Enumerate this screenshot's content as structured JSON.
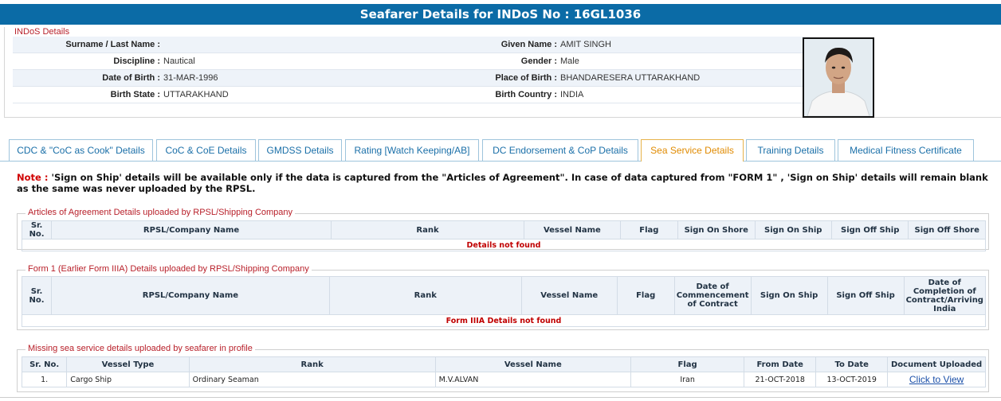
{
  "header": {
    "title": "Seafarer Details for INDoS No : 16GL1036"
  },
  "indos": {
    "legend": "INDoS Details",
    "rows": [
      {
        "l1": "Surname / Last Name :",
        "v1": "",
        "l2": "Given Name :",
        "v2": "AMIT SINGH"
      },
      {
        "l1": "Discipline :",
        "v1": "Nautical",
        "l2": "Gender :",
        "v2": "Male"
      },
      {
        "l1": "Date of Birth :",
        "v1": "31-MAR-1996",
        "l2": "Place of Birth :",
        "v2": "BHANDARESERA UTTARAKHAND"
      },
      {
        "l1": "Birth State :",
        "v1": "UTTARAKHAND",
        "l2": "Birth Country :",
        "v2": "INDIA"
      }
    ]
  },
  "tabs": [
    "CDC & \"CoC as Cook\" Details",
    "CoC & CoE Details",
    "GMDSS Details",
    "Rating [Watch Keeping/AB]",
    "DC Endorsement & CoP Details",
    "Sea Service Details",
    "Training Details",
    "Medical Fitness Certificate"
  ],
  "note": {
    "prefix": "Note :",
    "text": " 'Sign on Ship' details will be available only if the data is captured from the \"Articles of Agreement\". In case of data captured from \"FORM 1\" , 'Sign on Ship' details will remain blank as the same was never uploaded by the RPSL."
  },
  "articles": {
    "legend": "Articles of Agreement Details uploaded by RPSL/Shipping Company",
    "headers": [
      "Sr. No.",
      "RPSL/Company Name",
      "Rank",
      "Vessel Name",
      "Flag",
      "Sign On Shore",
      "Sign On Ship",
      "Sign Off Ship",
      "Sign Off Shore"
    ],
    "empty": "Details not found"
  },
  "form1": {
    "legend": "Form 1 (Earlier Form IIIA) Details uploaded by RPSL/Shipping Company",
    "headers": [
      "Sr. No.",
      "RPSL/Company Name",
      "Rank",
      "Vessel Name",
      "Flag",
      "Date of Commencement of Contract",
      "Sign On Ship",
      "Sign Off Ship",
      "Date of Completion of Contract/Arriving India"
    ],
    "empty": "Form IIIA Details not found"
  },
  "missing": {
    "legend": "Missing sea service details uploaded by seafarer in profile",
    "headers": [
      "Sr. No.",
      "Vessel Type",
      "Rank",
      "Vessel Name",
      "Flag",
      "From Date",
      "To Date",
      "Document Uploaded"
    ],
    "rows": [
      {
        "sr": "1.",
        "vessel_type": "Cargo Ship",
        "rank": "Ordinary Seaman",
        "vessel_name": "M.V.ALVAN",
        "flag": "Iran",
        "from": "21-OCT-2018",
        "to": "13-OCT-2019",
        "doc": "Click to View"
      }
    ]
  },
  "colors": {
    "header_bg": "#0b6ba6",
    "legend": "#b8202a",
    "active_tab": "#e08a00",
    "tab_text": "#1a6fa8",
    "not_found": "#c00000"
  }
}
